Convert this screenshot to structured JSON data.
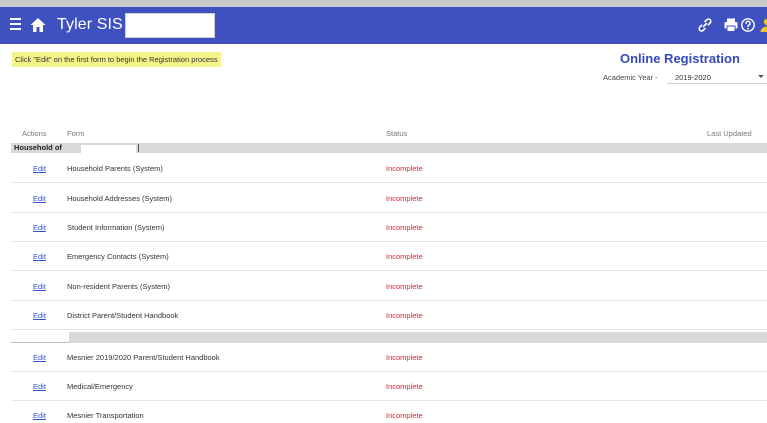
{
  "header": {
    "app_title": "Tyler SIS",
    "icons": [
      "menu-icon",
      "home-icon",
      "link-icon",
      "print-icon",
      "help-icon",
      "user-icon"
    ],
    "bar_color": "#3f51c0",
    "user_icon_color": "#f5c518"
  },
  "instruction": "Click \"Edit\" on the first form to begin the Registration process",
  "page_title": "Online Registration",
  "academic_year": {
    "label": "Academic Year -",
    "value": "2019-2020"
  },
  "table": {
    "headers": {
      "actions": "Actions",
      "form": "Form",
      "status": "Status",
      "last_updated": "Last Updated"
    },
    "group1": {
      "label": "Household of",
      "rows": [
        {
          "action": "Edit",
          "form": "Household Parents (System)",
          "status": "Incomplete"
        },
        {
          "action": "Edit",
          "form": "Household Addresses (System)",
          "status": "Incomplete"
        },
        {
          "action": "Edit",
          "form": "Student Information (System)",
          "status": "Incomplete"
        },
        {
          "action": "Edit",
          "form": "Emergency Contacts (System)",
          "status": "Incomplete"
        },
        {
          "action": "Edit",
          "form": "Non-resident Parents (System)",
          "status": "Incomplete"
        },
        {
          "action": "Edit",
          "form": "District Parent/Student Handbook",
          "status": "Incomplete"
        }
      ]
    },
    "group2": {
      "rows": [
        {
          "action": "Edit",
          "form": "Mesnier 2019/2020 Parent/Student Handbook",
          "status": "Incomplete"
        },
        {
          "action": "Edit",
          "form": "Medical/Emergency",
          "status": "Incomplete"
        },
        {
          "action": "Edit",
          "form": "Mesnier Transportation",
          "status": "Incomplete"
        }
      ]
    },
    "status_color": "#e8202a",
    "link_color": "#2c4fd0"
  }
}
